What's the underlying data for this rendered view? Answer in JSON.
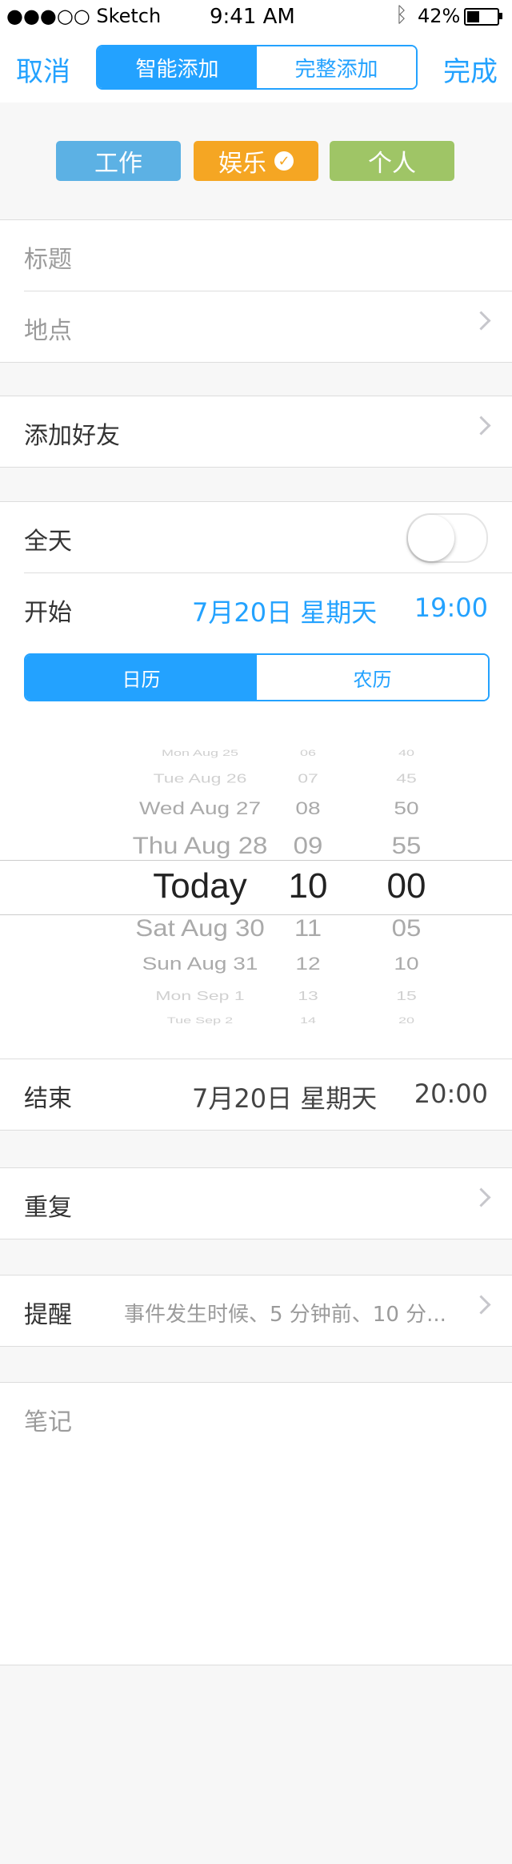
{
  "status_bar": {
    "carrier": "●●●○○ Sketch",
    "time": "9:41 AM",
    "battery_percent": "42%",
    "battery_level": 0.42
  },
  "nav": {
    "cancel": "取消",
    "done": "完成",
    "segments": [
      "智能添加",
      "完整添加"
    ],
    "active_segment": 0
  },
  "tags": [
    {
      "label": "工作",
      "color": "#5CB1E4"
    },
    {
      "label": "娱乐",
      "color": "#F5A623",
      "selected": true
    },
    {
      "label": "个人",
      "color": "#9FC566"
    }
  ],
  "form": {
    "title_placeholder": "标题",
    "location_placeholder": "地点",
    "add_friends": "添加好友",
    "all_day": "全天",
    "all_day_on": false,
    "start_label": "开始",
    "start_date": "7月20日 星期天",
    "start_time": "19:00",
    "calendar_types": [
      "日历",
      "农历"
    ],
    "end_label": "结束",
    "end_date": "7月20日 星期天",
    "end_time": "20:00",
    "repeat": "重复",
    "reminder": "提醒",
    "reminder_value": "事件发生时候、5 分钟前、10 分...",
    "notes_placeholder": "笔记"
  },
  "picker": {
    "dates": [
      "Mon Aug 25",
      "Tue Aug 26",
      "Wed Aug 27",
      "Thu Aug 28",
      "Today",
      "Sat Aug 30",
      "Sun Aug 31",
      "Mon Sep 1",
      "Tue Sep 2"
    ],
    "hours": [
      "06",
      "07",
      "08",
      "09",
      "10",
      "11",
      "12",
      "13",
      "14"
    ],
    "minutes": [
      "40",
      "45",
      "50",
      "55",
      "00",
      "05",
      "10",
      "15",
      "20"
    ]
  },
  "colors": {
    "accent": "#23A2FF",
    "placeholder": "#9B9B9B"
  }
}
